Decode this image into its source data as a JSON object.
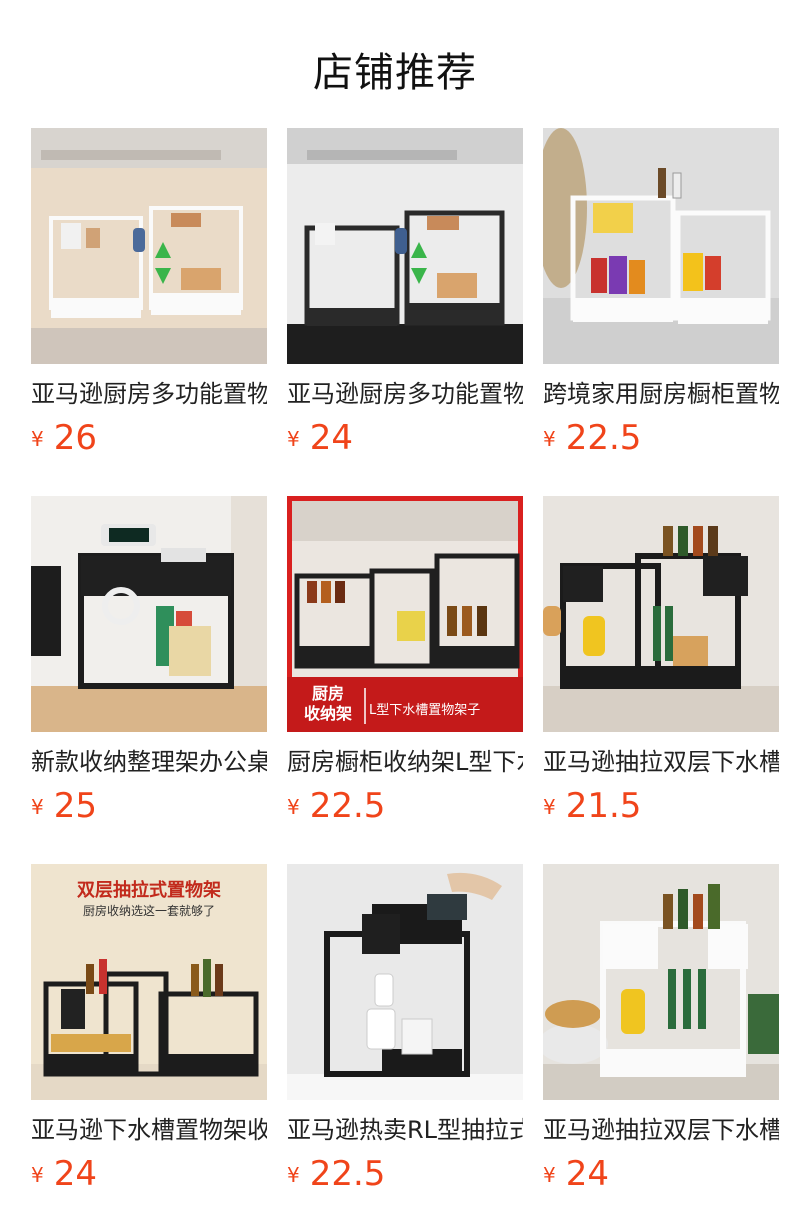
{
  "page": {
    "title": "店铺推荐"
  },
  "currency_symbol": "¥",
  "products": [
    {
      "name": "亚马逊厨房多功能置物架",
      "price": "26",
      "image_icon": "kitchen-rack-white-image"
    },
    {
      "name": "亚马逊厨房多功能置物架",
      "price": "24",
      "image_icon": "kitchen-rack-black-image"
    },
    {
      "name": "跨境家用厨房橱柜置物架",
      "price": "22.5",
      "image_icon": "cabinet-rack-white-image"
    },
    {
      "name": "新款收纳整理架办公桌",
      "price": "25",
      "image_icon": "desk-organizer-image"
    },
    {
      "name": "厨房橱柜收纳架L型下水槽",
      "price": "22.5",
      "image_icon": "l-shape-rack-image",
      "overlay": {
        "badge": "厨房\n收纳架",
        "caption": "L型下水槽置物架子"
      }
    },
    {
      "name": "亚马逊抽拉双层下水槽",
      "price": "21.5",
      "image_icon": "double-layer-rack-image"
    },
    {
      "name": "亚马逊下水槽置物架收纳",
      "price": "24",
      "image_icon": "sink-rack-banner-image",
      "overlay": {
        "headline": "双层抽拉式置物架",
        "sub": "厨房收纳选这一套就够了"
      }
    },
    {
      "name": "亚马逊热卖RL型抽拉式",
      "price": "22.5",
      "image_icon": "rl-drawer-rack-image"
    },
    {
      "name": "亚马逊抽拉双层下水槽",
      "price": "24",
      "image_icon": "white-double-rack-image"
    }
  ]
}
